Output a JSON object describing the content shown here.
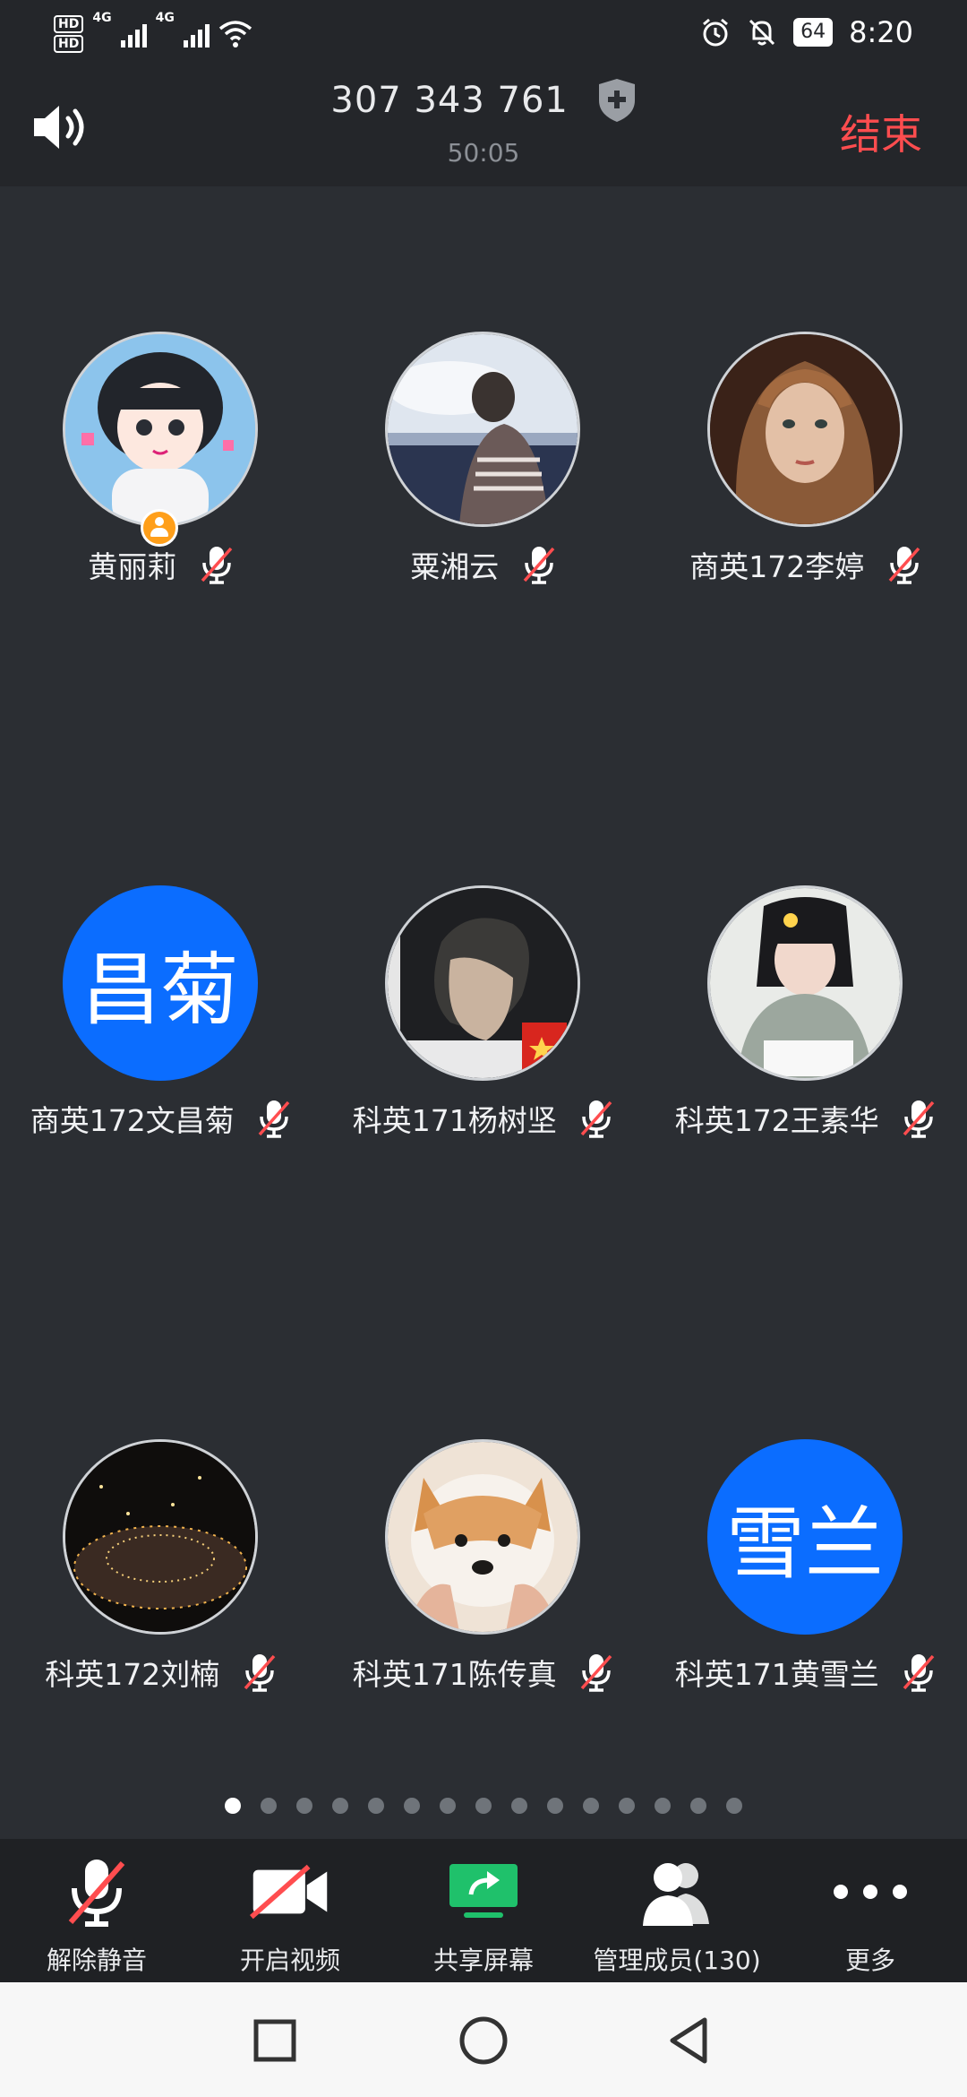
{
  "status_bar": {
    "time": "8:20",
    "battery": "64",
    "hd1": "HD",
    "hd2": "HD",
    "network": "4G"
  },
  "header": {
    "meeting_id": "307 343 761",
    "timer": "50:05",
    "end_label": "结束"
  },
  "participants": [
    {
      "name": "黄丽莉",
      "avatar": "photo",
      "host": true,
      "muted": true
    },
    {
      "name": "粟湘云",
      "avatar": "photo",
      "muted": true
    },
    {
      "name": "商英172李婷",
      "avatar": "photo",
      "muted": true
    },
    {
      "name": "商英172文昌菊",
      "avatar": "initials",
      "initials": "昌菊",
      "muted": true
    },
    {
      "name": "科英171杨树坚",
      "avatar": "photo",
      "muted": true
    },
    {
      "name": "科英172王素华",
      "avatar": "photo",
      "muted": true
    },
    {
      "name": "科英172刘楠",
      "avatar": "photo",
      "muted": true
    },
    {
      "name": "科英171陈传真",
      "avatar": "photo",
      "muted": true
    },
    {
      "name": "科英171黄雪兰",
      "avatar": "initials",
      "initials": "雪兰",
      "muted": true
    }
  ],
  "pagination": {
    "total_pages": 15,
    "current_page": 1
  },
  "toolbar": {
    "unmute_label": "解除静音",
    "video_label": "开启视频",
    "share_label": "共享屏幕",
    "members_label": "管理成员(130)",
    "more_label": "更多"
  },
  "colors": {
    "end_red": "#ff4d4f",
    "initials_blue": "#0b6dff",
    "share_green": "#1fc16b",
    "host_orange": "#ff9f1a"
  },
  "icons": {
    "speaker": "speaker-icon",
    "shield": "shield-icon",
    "mic_muted": "mic-muted-icon",
    "video_off": "video-off-icon",
    "share_screen": "share-screen-icon",
    "members": "members-icon",
    "more": "more-dots-icon"
  }
}
